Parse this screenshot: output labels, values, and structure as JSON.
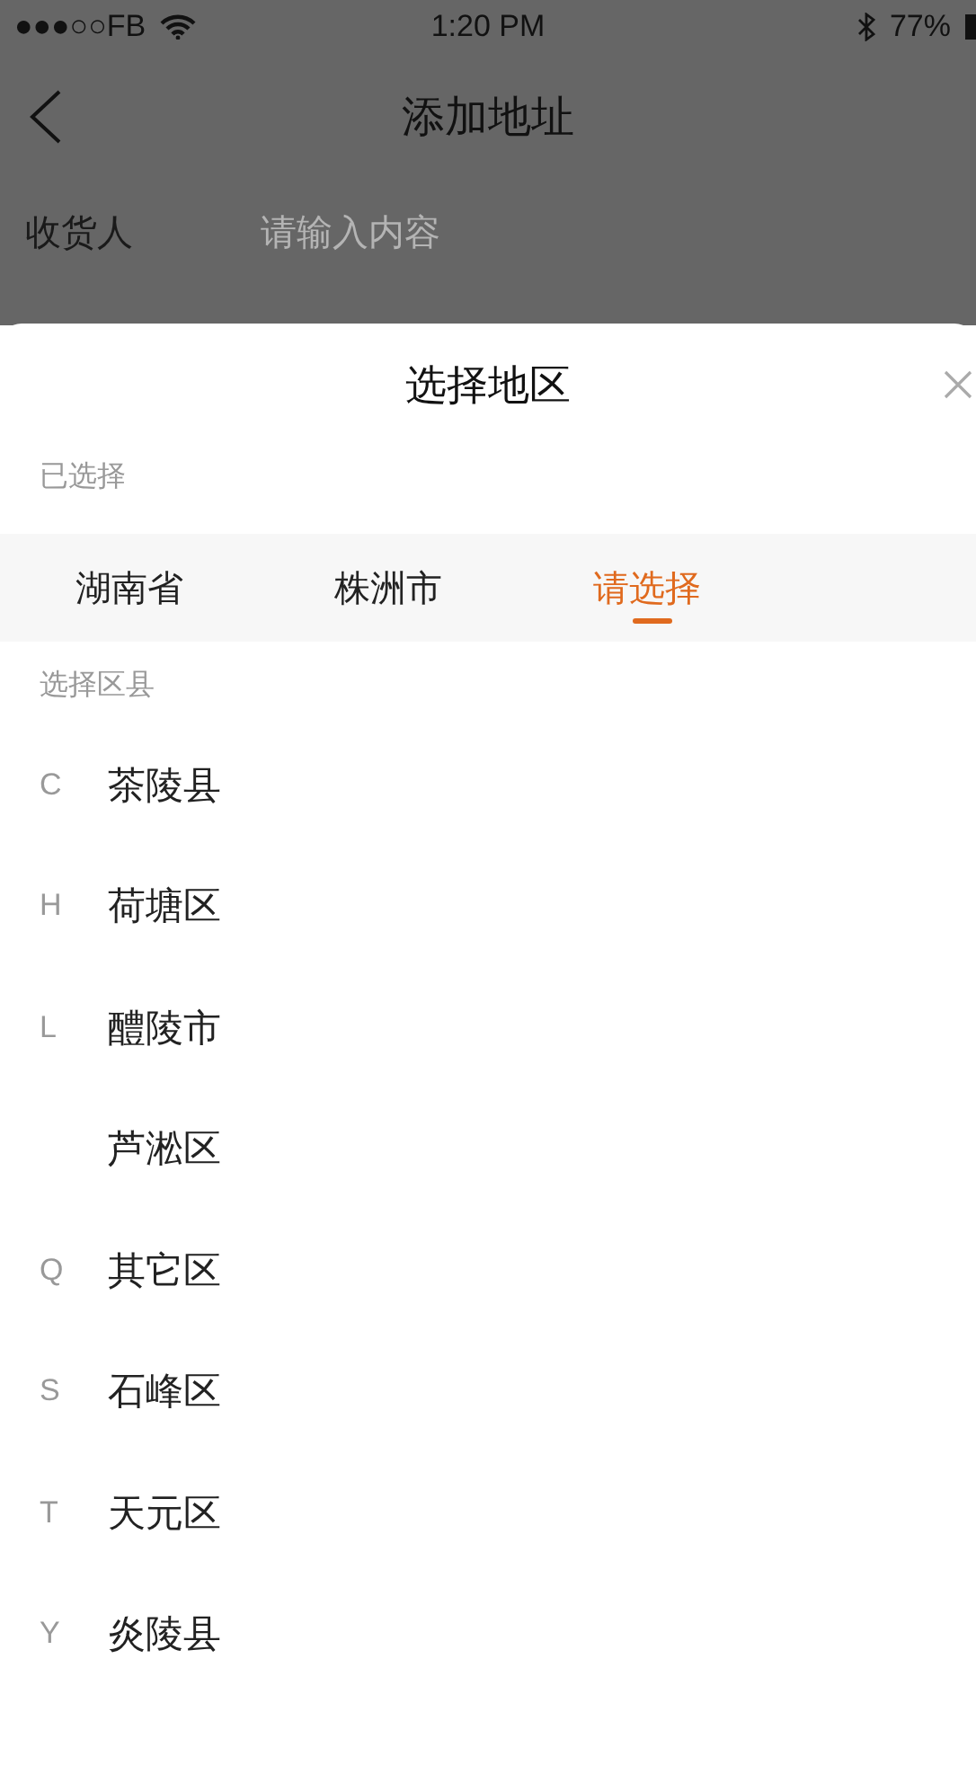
{
  "status_bar": {
    "carrier": "●●●○○FB",
    "time": "1:20 PM",
    "battery": "77%"
  },
  "nav": {
    "title": "添加地址"
  },
  "form": [
    {
      "label": "收货人",
      "placeholder": "请输入内容"
    }
  ],
  "sheet": {
    "title": "选择地区",
    "selected_label": "已选择",
    "tabs": [
      {
        "label": "湖南省",
        "selected": false
      },
      {
        "label": "株洲市",
        "selected": false
      },
      {
        "label": "请选择",
        "selected": true
      }
    ],
    "section_label": "选择区县",
    "items": [
      {
        "letter": "C",
        "name": "茶陵县"
      },
      {
        "letter": "H",
        "name": "荷塘区"
      },
      {
        "letter": "L",
        "name": "醴陵市"
      },
      {
        "name": "芦淞区"
      },
      {
        "letter": "Q",
        "name": "其它区"
      },
      {
        "letter": "S",
        "name": "石峰区"
      },
      {
        "letter": "T",
        "name": "天元区"
      },
      {
        "letter": "Y",
        "name": "炎陵县"
      }
    ]
  }
}
